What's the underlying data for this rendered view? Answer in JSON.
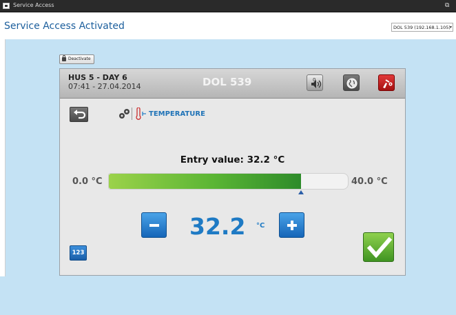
{
  "window": {
    "title": "Service Access",
    "popout_icon": "popout-icon"
  },
  "header": {
    "title": "Service Access Activated",
    "device_select": "DOL 539 (192.168.1.105)"
  },
  "controls": {
    "deactivate_label": "Deactivate"
  },
  "panel": {
    "house": "HUS 5 - DAY 6",
    "datetime": "07:41 - 27.04.2014",
    "device": "DOL 539",
    "breadcrumb": "TEMPERATURE",
    "entry_label": "Entry value: 32.2 °C",
    "min": "0.0 °C",
    "max": "40.0 °C",
    "value": "32.2",
    "unit": "°C",
    "numpad_label": "123"
  },
  "slider": {
    "min": 0.0,
    "max": 40.0,
    "value": 32.2
  },
  "colors": {
    "accent": "#1e7ac4",
    "title": "#1b5e9c",
    "ok": "#5ab534",
    "alarm": "#c81e1e",
    "background": "#c4e2f4"
  }
}
